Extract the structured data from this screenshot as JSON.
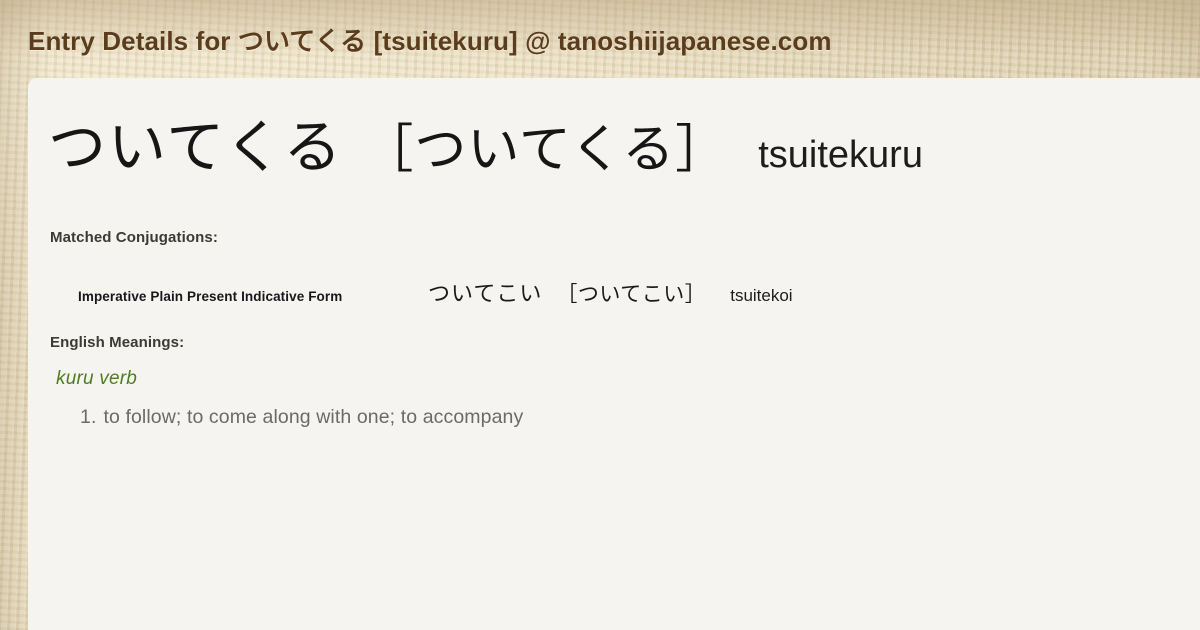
{
  "header": {
    "title": "Entry Details for ついてくる [tsuitekuru] @ tanoshiijapanese.com"
  },
  "entry": {
    "kana": "ついてくる",
    "reading": "［ついてくる］",
    "romaji": "tsuitekuru"
  },
  "conjugations": {
    "label": "Matched Conjugations:",
    "rows": [
      {
        "form": "Imperative Plain Present Indicative Form",
        "kana": "ついてこい",
        "reading": "［ついてこい］",
        "romaji": "tsuitekoi"
      }
    ]
  },
  "meanings": {
    "label": "English Meanings:",
    "part_of_speech": "kuru verb",
    "senses": [
      {
        "number": "1.",
        "text": "to follow; to come along with one; to accompany"
      }
    ]
  },
  "colors": {
    "header_text": "#5b3c1c",
    "page_background": "#e8dcbd",
    "card_background": "#f5f4f0",
    "part_of_speech": "#4f7d22",
    "sense_text": "#6a6a6a"
  }
}
